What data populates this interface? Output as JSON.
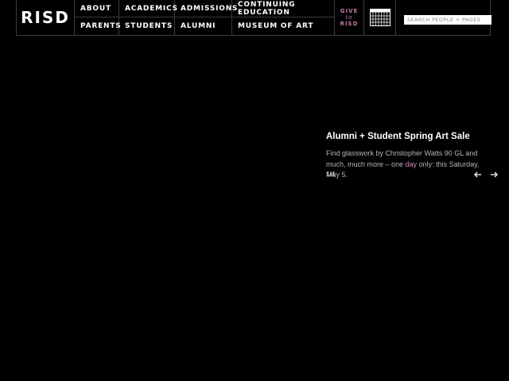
{
  "header": {
    "logo": "RISD",
    "nav_row1": [
      "ABOUT",
      "ACADEMICS",
      "ADMISSIONS",
      "CONTINUING EDUCATION"
    ],
    "nav_row2": [
      "PARENTS",
      "STUDENTS",
      "ALUMNI",
      "MUSEUM OF ART"
    ],
    "give": {
      "line1": "GIVE",
      "line2": "to",
      "line3": "RISD"
    },
    "calendar_icon": "calendar-icon",
    "search_placeholder": "SEARCH PEOPLE + PAGES"
  },
  "slide": {
    "title": "Alumni + Student Spring Art Sale",
    "desc_before": "Find glasswork by Christopher Watts 90 GL and much, much more – one ",
    "desc_link": "day",
    "desc_after": " only: this Saturday, May 5.",
    "counter": "1/4",
    "prev_icon": "arrow-left-icon",
    "next_icon": "arrow-right-icon"
  },
  "colors": {
    "background": "#000000",
    "accent": "#c27aa5",
    "border": "#3a3a3a"
  }
}
